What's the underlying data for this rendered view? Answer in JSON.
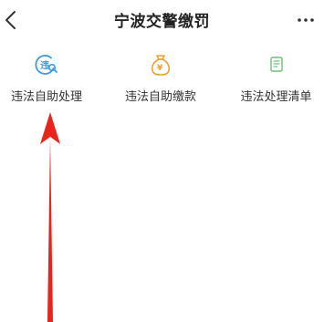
{
  "header": {
    "title": "宁波交警缴罚",
    "back_icon": "chevron-left-icon",
    "more_icon": "more-dots-icon"
  },
  "functions": [
    {
      "label": "违法自助处理",
      "icon": "violation-search-icon",
      "color": "#3a9be0"
    },
    {
      "label": "违法自助缴款",
      "icon": "money-bag-icon",
      "color": "#f0a030"
    },
    {
      "label": "违法处理清单",
      "icon": "document-list-icon",
      "color": "#6fc07a"
    }
  ],
  "annotation": {
    "arrow_color": "#e8241c",
    "icon": "red-arrow-up-icon"
  }
}
